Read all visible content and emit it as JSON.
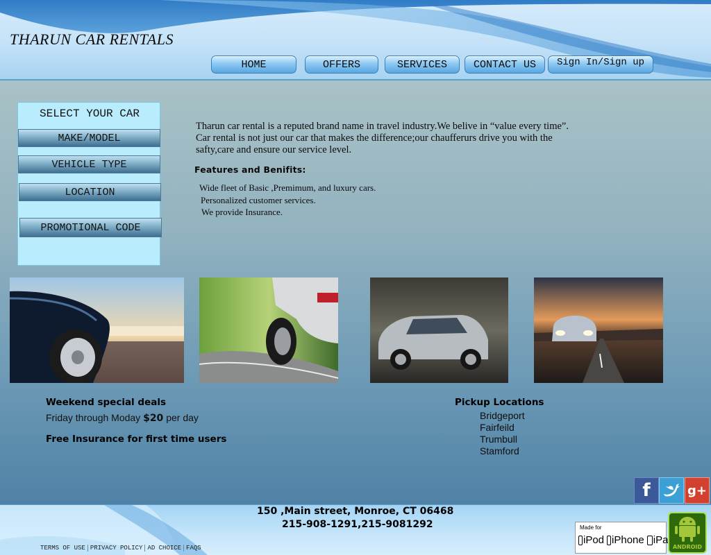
{
  "header": {
    "site_title": "THARUN CAR RENTALS",
    "nav": [
      "HOME",
      "OFFERS",
      "SERVICES",
      "CONTACT US",
      "Sign In/Sign up"
    ]
  },
  "sidebar": {
    "title": "SELECT YOUR CAR",
    "buttons": [
      "MAKE/MODEL",
      "VEHICLE TYPE",
      "LOCATION",
      "PROMOTIONAL CODE"
    ]
  },
  "intro": {
    "lines": [
      "Tharun car rental is a reputed brand name in travel industry.We belive in “value every time”.",
      "Car rental is not just our car that makes the difference;our chaufferurs drive you with the",
      "safty,care and ensure our service level."
    ]
  },
  "features": {
    "title": "Features and Benifits:",
    "items": [
      "Wide fleet of Basic ,Premimum, and luxury cars.",
      "Personalized customer services.",
      "We provide Insurance."
    ]
  },
  "deals": {
    "title": "Weekend special deals",
    "line_prefix": "Friday through Moday",
    "price": "$20",
    "line_suffix": "per day",
    "insurance": "Free Insurance for first time users"
  },
  "locations": {
    "title": "Pickup Locations",
    "items": [
      "Bridgeport",
      "Fairfeild",
      "Trumbull",
      "Stamford"
    ]
  },
  "footer": {
    "address": "150 ,Main street, Monroe, CT 06468",
    "phone": "215-908-1291,215-9081292",
    "links": [
      "TERMS OF USE",
      "PRIVACY POLICY",
      "AD CHOICE",
      "FAQS"
    ],
    "apple_badge": {
      "made_for": "Made for",
      "devices": [
        "iPod",
        "iPhone",
        "iPad"
      ]
    },
    "android_badge": "ANDROID"
  },
  "social": {
    "facebook": "f",
    "googleplus": "g+"
  },
  "icons": [
    "facebook-icon",
    "twitter-icon",
    "google-plus-icon",
    "apple-icon",
    "android-icon"
  ],
  "colors": {
    "facebook": "#3b5998",
    "twitter": "#3aa0d6",
    "googleplus": "#d2412f",
    "android": "#a4c639"
  }
}
